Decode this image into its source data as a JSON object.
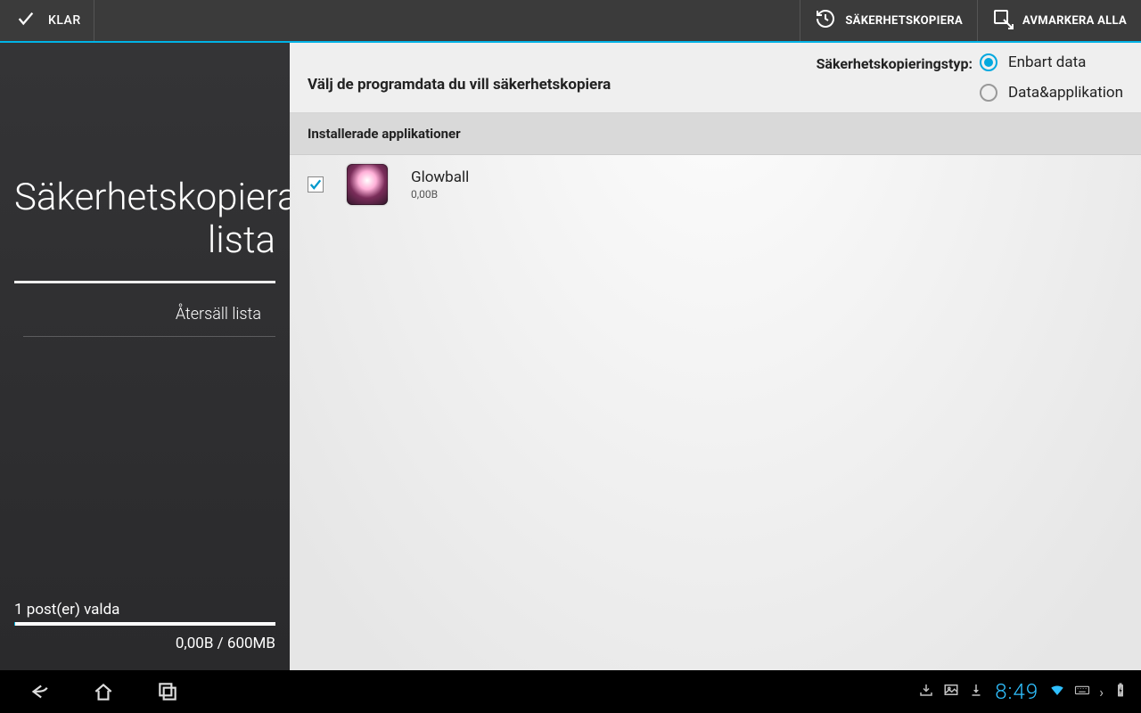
{
  "actionbar": {
    "done_label": "KLAR",
    "backup_label": "SÄKERHETSKOPIERA",
    "deselect_label": "AVMARKERA ALLA"
  },
  "sidebar": {
    "title": "Säkerhetskopiera lista",
    "restore_label": "Återsäll lista",
    "selected_label": "1 post(er) valda",
    "size_label": "0,00B / 600MB"
  },
  "main": {
    "prompt": "Välj de programdata du vill säkerhetskopiera",
    "type_label": "Säkerhetskopieringstyp:",
    "radio_data_only": "Enbart data",
    "radio_data_app": "Data&applikation",
    "section_installed": "Installerade applikationer",
    "apps": [
      {
        "name": "Glowball",
        "size": "0,00B",
        "checked": true
      }
    ]
  },
  "navbar": {
    "clock": "8:49"
  }
}
